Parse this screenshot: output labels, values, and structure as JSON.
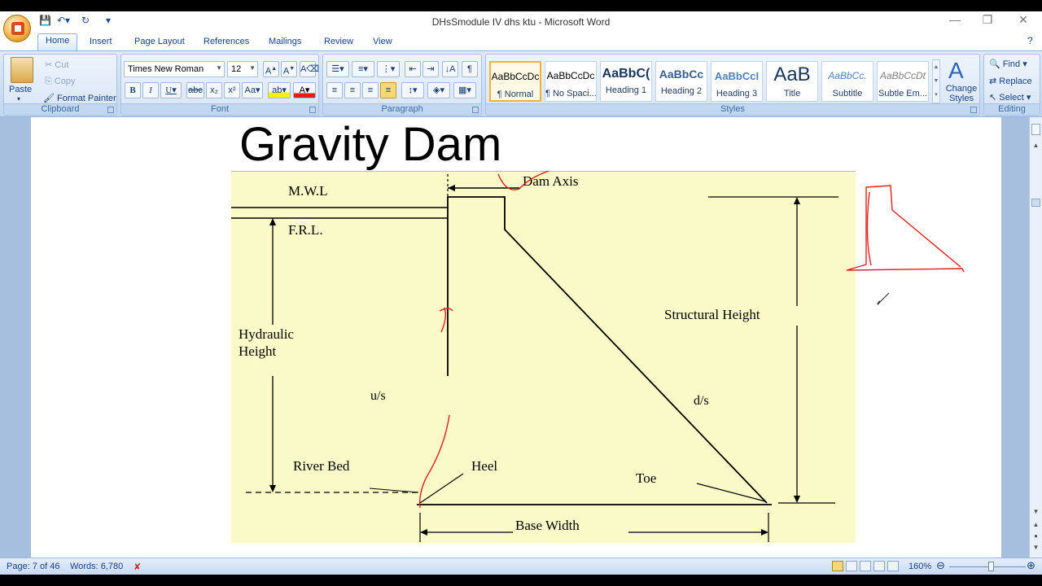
{
  "window": {
    "title": "DHsSmodule IV dhs  ktu - Microsoft Word",
    "controls": [
      "—",
      "❐",
      "✕"
    ]
  },
  "tabs": [
    "Home",
    "Insert",
    "Page Layout",
    "References",
    "Mailings",
    "Review",
    "View"
  ],
  "ribbon": {
    "clipboard": {
      "label": "Clipboard",
      "paste": "Paste",
      "cut": "Cut",
      "copy": "Copy",
      "format_painter": "Format Painter"
    },
    "font": {
      "label": "Font",
      "font_name": "Times New Roman",
      "font_size": "12"
    },
    "paragraph": {
      "label": "Paragraph"
    },
    "styles": {
      "label": "Styles",
      "items": [
        {
          "sample": "AaBbCcDc",
          "name": "¶ Normal"
        },
        {
          "sample": "AaBbCcDc",
          "name": "¶ No Spaci..."
        },
        {
          "sample": "AaBbC(",
          "name": "Heading 1"
        },
        {
          "sample": "AaBbCc",
          "name": "Heading 2"
        },
        {
          "sample": "AaBbCcI",
          "name": "Heading 3"
        },
        {
          "sample": "AaB",
          "name": "Title"
        },
        {
          "sample": "AaBbCc.",
          "name": "Subtitle"
        },
        {
          "sample": "AaBbCcDt",
          "name": "Subtle Em..."
        }
      ],
      "change_styles": "Change Styles"
    },
    "editing": {
      "label": "Editing",
      "find": "Find",
      "replace": "Replace",
      "select": "Select"
    }
  },
  "document": {
    "heading": "Gravity Dam",
    "figure_labels": {
      "mwl": "M.W.L",
      "frl": "F.R.L.",
      "dam_axis": "Dam Axis",
      "structural_height": "Structural Height",
      "hydraulic_height_1": "Hydraulic",
      "hydraulic_height_2": "Height",
      "us": "u/s",
      "ds": "d/s",
      "river_bed": "River Bed",
      "heel": "Heel",
      "toe": "Toe",
      "base_width": "Base Width"
    }
  },
  "status": {
    "page": "Page: 7 of 46",
    "words": "Words: 6,780",
    "zoom": "160%"
  },
  "colors": {
    "figure_bg": "#fafac8",
    "annotation": "#e02020",
    "ribbon_text": "#15428b"
  }
}
